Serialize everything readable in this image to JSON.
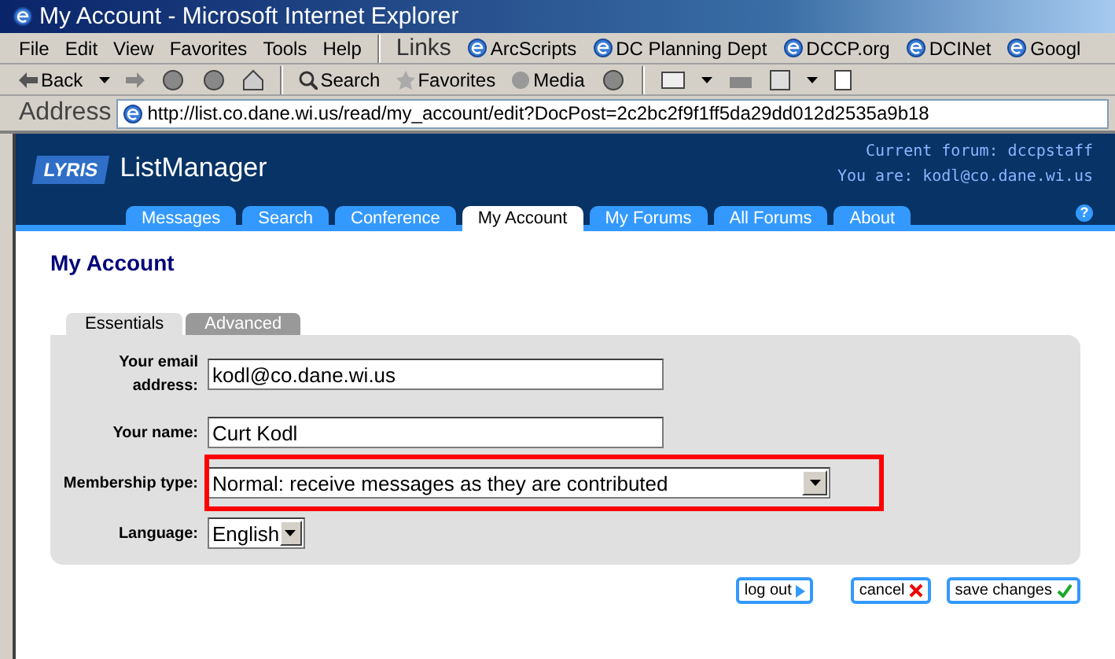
{
  "window": {
    "title": "My Account - Microsoft Internet Explorer"
  },
  "menu": [
    "File",
    "Edit",
    "View",
    "Favorites",
    "Tools",
    "Help"
  ],
  "links": {
    "label": "Links",
    "items": [
      "ArcScripts",
      "DC Planning Dept",
      "DCCP.org",
      "DCINet",
      "Googl"
    ]
  },
  "toolbar": {
    "back": "Back",
    "search": "Search",
    "favorites": "Favorites",
    "media": "Media"
  },
  "address": {
    "label": "Address",
    "url": "http://list.co.dane.wi.us/read/my_account/edit?DocPost=2c2bc2f9f1ff5da29dd012d2535a9b18"
  },
  "header": {
    "logo": "LYRIS",
    "product": "ListManager",
    "forum": "Current forum: dccpstaff",
    "user": "You are: kodl@co.dane.wi.us",
    "help": "?"
  },
  "tabs": [
    {
      "label": "Messages",
      "selected": false
    },
    {
      "label": "Search",
      "selected": false
    },
    {
      "label": "Conference",
      "selected": false
    },
    {
      "label": "My Account",
      "selected": true
    },
    {
      "label": "My Forums",
      "selected": false
    },
    {
      "label": "All Forums",
      "selected": false
    },
    {
      "label": "About",
      "selected": false
    }
  ],
  "heading": "My Account",
  "subtabs": [
    {
      "label": "Essentials",
      "selected": true
    },
    {
      "label": "Advanced",
      "selected": false
    }
  ],
  "fields": [
    {
      "kind": "text",
      "label": "Your email address:",
      "value": "kodl@co.dane.wi.us",
      "highlighted": false
    },
    {
      "kind": "text",
      "label": "Your name:",
      "value": "Curt Kodl",
      "highlighted": false
    },
    {
      "kind": "select",
      "label": "Membership type:",
      "value": "Normal: receive messages as they are contributed",
      "highlighted": true
    },
    {
      "kind": "small-select",
      "label": "Language:",
      "value": "English",
      "highlighted": false
    }
  ],
  "buttons": [
    {
      "label": "log out",
      "kind": "next"
    },
    {
      "label": "cancel",
      "kind": "cancel"
    },
    {
      "label": "save changes",
      "kind": "ok"
    }
  ]
}
